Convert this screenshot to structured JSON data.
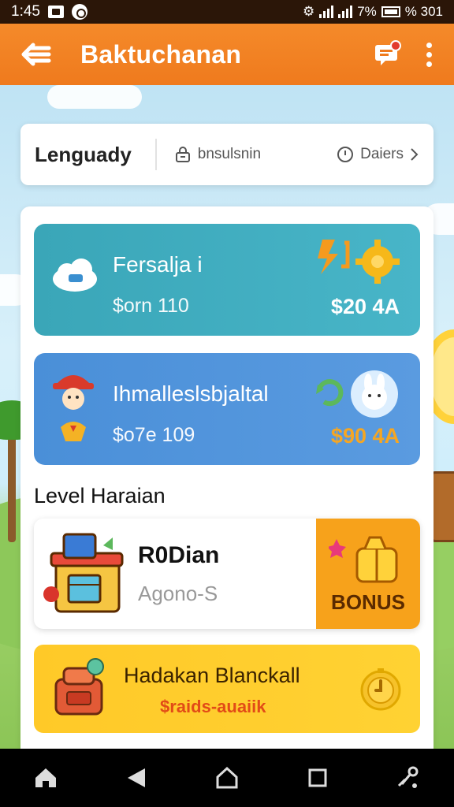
{
  "status_bar": {
    "time": "1:45",
    "right_text": "% 301",
    "signal_text": "7%",
    "icons": [
      "image-icon",
      "chat-bubble-icon",
      "vibrate-icon",
      "signal-icon",
      "battery-icon"
    ]
  },
  "header": {
    "title": "Baktuchanan",
    "back_icon": "back-arrow-icon",
    "notif_icon": "notification-icon",
    "menu_icon": "more-vert-icon"
  },
  "filter": {
    "title": "Lenguady",
    "tab_left": "bnsulsnin",
    "tab_right": "Daiers",
    "tab_left_icon": "lock-icon",
    "tab_right_icon": "clock-icon"
  },
  "offers": [
    {
      "name": "Fersalja i",
      "sub": "$orn 110",
      "amount": "$20 4A",
      "left_icon": "cloud-chat-icon",
      "right_icon": "gear-lightning-icon"
    },
    {
      "name": "Ihmalleslsbjaltal",
      "sub": "$o7e 109",
      "amount": "$90 4A",
      "left_icon": "character-icon",
      "right_icon": "bunny-icon"
    }
  ],
  "section": {
    "title": "Level Haraian"
  },
  "level_card": {
    "name": "R0Dian",
    "sub": "Agono-S",
    "bonus_label": "BONUS",
    "icon": "shop-chest-icon",
    "bonus_icon": "gift-box-icon"
  },
  "promo": {
    "title": "Hadakan Blanckall",
    "sub": "$raids-auaiik",
    "icon": "backpack-icon",
    "right_icon": "stopwatch-icon"
  },
  "nav": {
    "items": [
      "home-icon",
      "back-triangle-icon",
      "home-circle-icon",
      "recents-square-icon",
      "accessibility-icon"
    ]
  },
  "colors": {
    "header": "#f58a2a",
    "offer1": "#3aa6b8",
    "offer2": "#4a8fd8",
    "bonus": "#f7a21b",
    "promo": "#ffc928",
    "promo_sub": "#e24b17"
  }
}
